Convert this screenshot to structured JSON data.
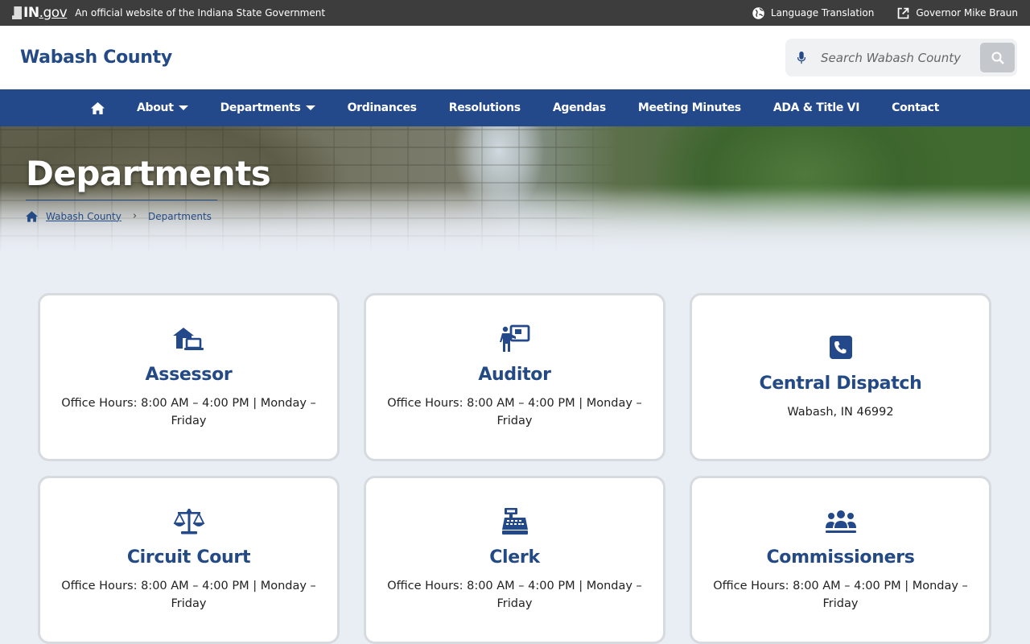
{
  "topbar": {
    "logo_text": "IN",
    "logo_suffix": ".gov",
    "official_text": "An official website of the Indiana State Government",
    "language_label": "Language Translation",
    "governor_label": "Governor Mike Braun"
  },
  "header": {
    "site_title": "Wabash County",
    "search_placeholder": "Search Wabash County"
  },
  "nav": {
    "items": [
      {
        "label": "About",
        "dropdown": true
      },
      {
        "label": "Departments",
        "dropdown": true
      },
      {
        "label": "Ordinances"
      },
      {
        "label": "Resolutions"
      },
      {
        "label": "Agendas"
      },
      {
        "label": "Meeting Minutes"
      },
      {
        "label": "ADA & Title VI"
      },
      {
        "label": "Contact"
      }
    ]
  },
  "hero": {
    "title": "Departments",
    "breadcrumb": {
      "home": "Wabash County",
      "current": "Departments"
    }
  },
  "cards": [
    {
      "title": "Assessor",
      "text": "Office Hours: 8:00 AM – 4:00 PM | Monday – Friday",
      "icon": "house-laptop-icon"
    },
    {
      "title": "Auditor",
      "text": "Office Hours: 8:00 AM – 4:00 PM | Monday – Friday",
      "icon": "presenter-board-icon"
    },
    {
      "title": "Central Dispatch",
      "text": "Wabash, IN 46992",
      "icon": "phone-square-icon"
    },
    {
      "title": "Circuit Court",
      "text": "Office Hours: 8:00 AM – 4:00 PM | Monday – Friday",
      "icon": "scales-icon"
    },
    {
      "title": "Clerk",
      "text": "Office Hours: 8:00 AM – 4:00 PM | Monday – Friday",
      "icon": "cash-register-icon"
    },
    {
      "title": "Commissioners",
      "text": "Office Hours: 8:00 AM – 4:00 PM | Monday – Friday",
      "icon": "people-group-icon"
    }
  ],
  "colors": {
    "brand_blue": "#234a85",
    "topbar_bg": "#3d3d3d",
    "page_bg": "#e9edf4"
  }
}
